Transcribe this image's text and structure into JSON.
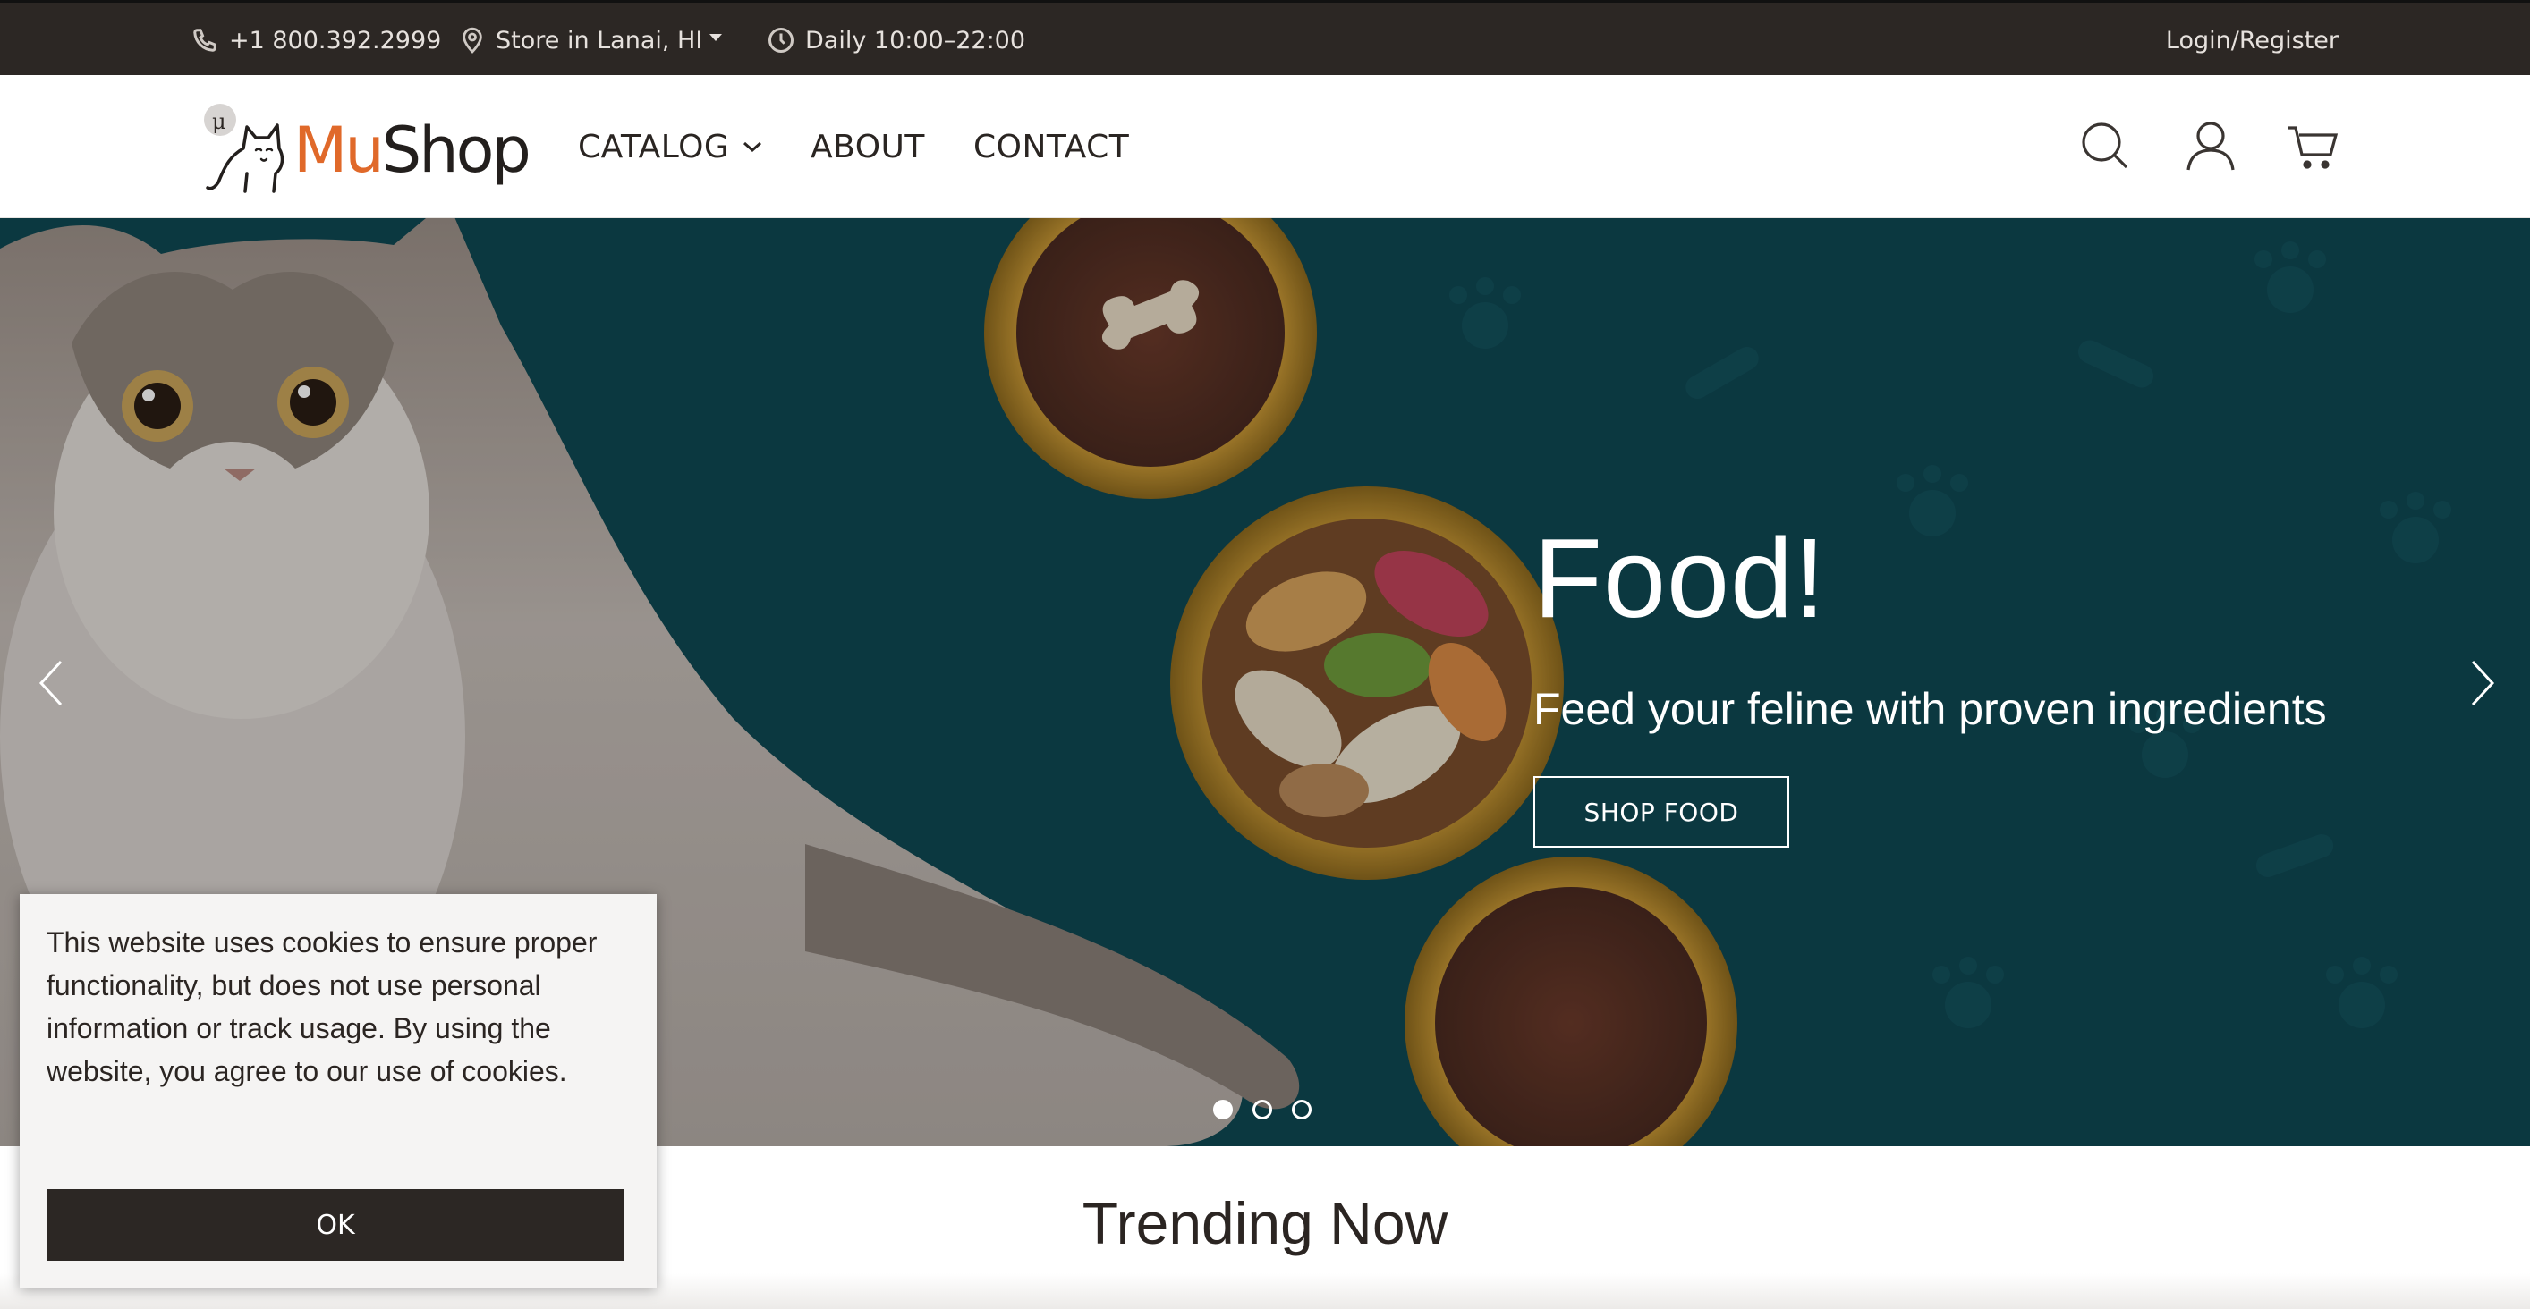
{
  "topbar": {
    "phone": "+1 800.392.2999",
    "store": "Store in Lanai, HI",
    "hours": "Daily 10:00–22:00",
    "login": "Login/Register"
  },
  "nav": {
    "logo_mu": "Mu",
    "logo_shop": "Shop",
    "catalog": "CATALOG",
    "about": "ABOUT",
    "contact": "CONTACT",
    "icons": [
      "search-icon",
      "user-icon",
      "cart-icon"
    ]
  },
  "hero": {
    "title": "Food!",
    "subtitle": "Feed your feline with proven ingredients",
    "button": "SHOP FOOD",
    "slides": 3,
    "active_slide": 1
  },
  "section": {
    "title": "Trending Now"
  },
  "cookie": {
    "text": "This website uses cookies to ensure proper functionality, but does not use personal information or track usage. By using the website, you agree to our use of cookies.",
    "ok": "OK"
  },
  "colors": {
    "dark": "#2c2724",
    "accent": "#e0692a",
    "hero_bg": "#0e4a56"
  }
}
